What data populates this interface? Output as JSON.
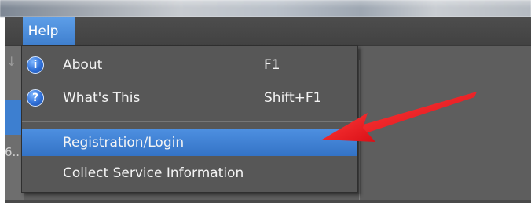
{
  "menubar": {
    "help_label": "Help"
  },
  "left_edge": {
    "truncated_text": "6.."
  },
  "help_menu": {
    "items": [
      {
        "icon": "info-icon",
        "icon_glyph": "i",
        "label": "About",
        "shortcut": "F1"
      },
      {
        "icon": "question-icon",
        "icon_glyph": "?",
        "label": "What's This",
        "shortcut": "Shift+F1"
      },
      {
        "label": "Registration/Login",
        "shortcut": ""
      },
      {
        "label": "Collect Service Information",
        "shortcut": ""
      }
    ],
    "highlighted_item": "Registration/Login"
  },
  "annotation": {
    "type": "red-arrow",
    "color": "#e8161d",
    "points_to": "Registration/Login"
  }
}
